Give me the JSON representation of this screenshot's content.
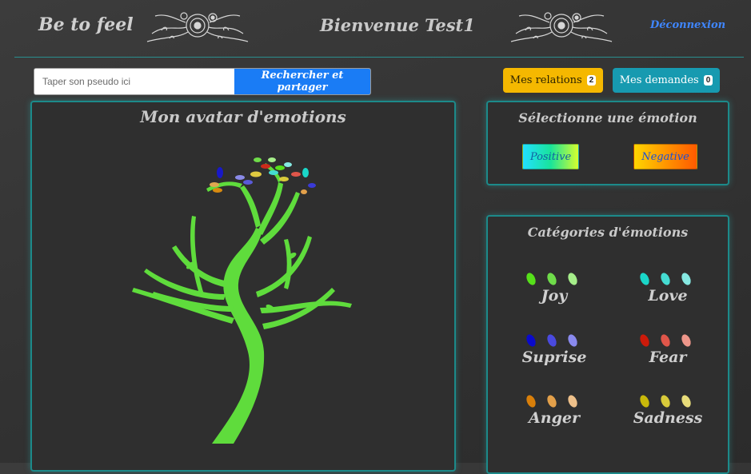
{
  "header": {
    "brand": "Be to feel",
    "welcome": "Bienvenue Test1",
    "logout": "Déconnexion"
  },
  "search": {
    "placeholder": "Taper son pseudo ici",
    "button_label": "Rechercher et partager"
  },
  "relations": {
    "label": "Mes relations",
    "count": "2"
  },
  "demandes": {
    "label": "Mes demandes",
    "count": "0"
  },
  "avatar_panel": {
    "title": "Mon avatar d'emotions"
  },
  "select_panel": {
    "title": "Sélectionne une émotion",
    "positive_label": "Positive",
    "negative_label": "Negative"
  },
  "categories_panel": {
    "title": "Catégories d'émotions",
    "items": [
      {
        "label": "Joy",
        "colors": [
          "#56e01a",
          "#6fdc4a",
          "#a6ee8a"
        ]
      },
      {
        "label": "Love",
        "colors": [
          "#1ad6c8",
          "#45dcd2",
          "#86e9e2"
        ]
      },
      {
        "label": "Suprise",
        "colors": [
          "#0a0acc",
          "#4a4adf",
          "#8a8aee"
        ]
      },
      {
        "label": "Fear",
        "colors": [
          "#cc1a0a",
          "#e0564a",
          "#ee968a"
        ]
      },
      {
        "label": "Anger",
        "colors": [
          "#d97f0a",
          "#e3a04a",
          "#eec08a"
        ]
      },
      {
        "label": "Sadness",
        "colors": [
          "#c8b80a",
          "#d8ca3a",
          "#e8dc7a"
        ]
      }
    ]
  },
  "colors": {
    "accent_teal": "#1c8a8a",
    "search_button": "#1a7cf5",
    "relations_button": "#f5b800",
    "demandes_button": "#179ab0",
    "tree": "#5fdc3c"
  }
}
